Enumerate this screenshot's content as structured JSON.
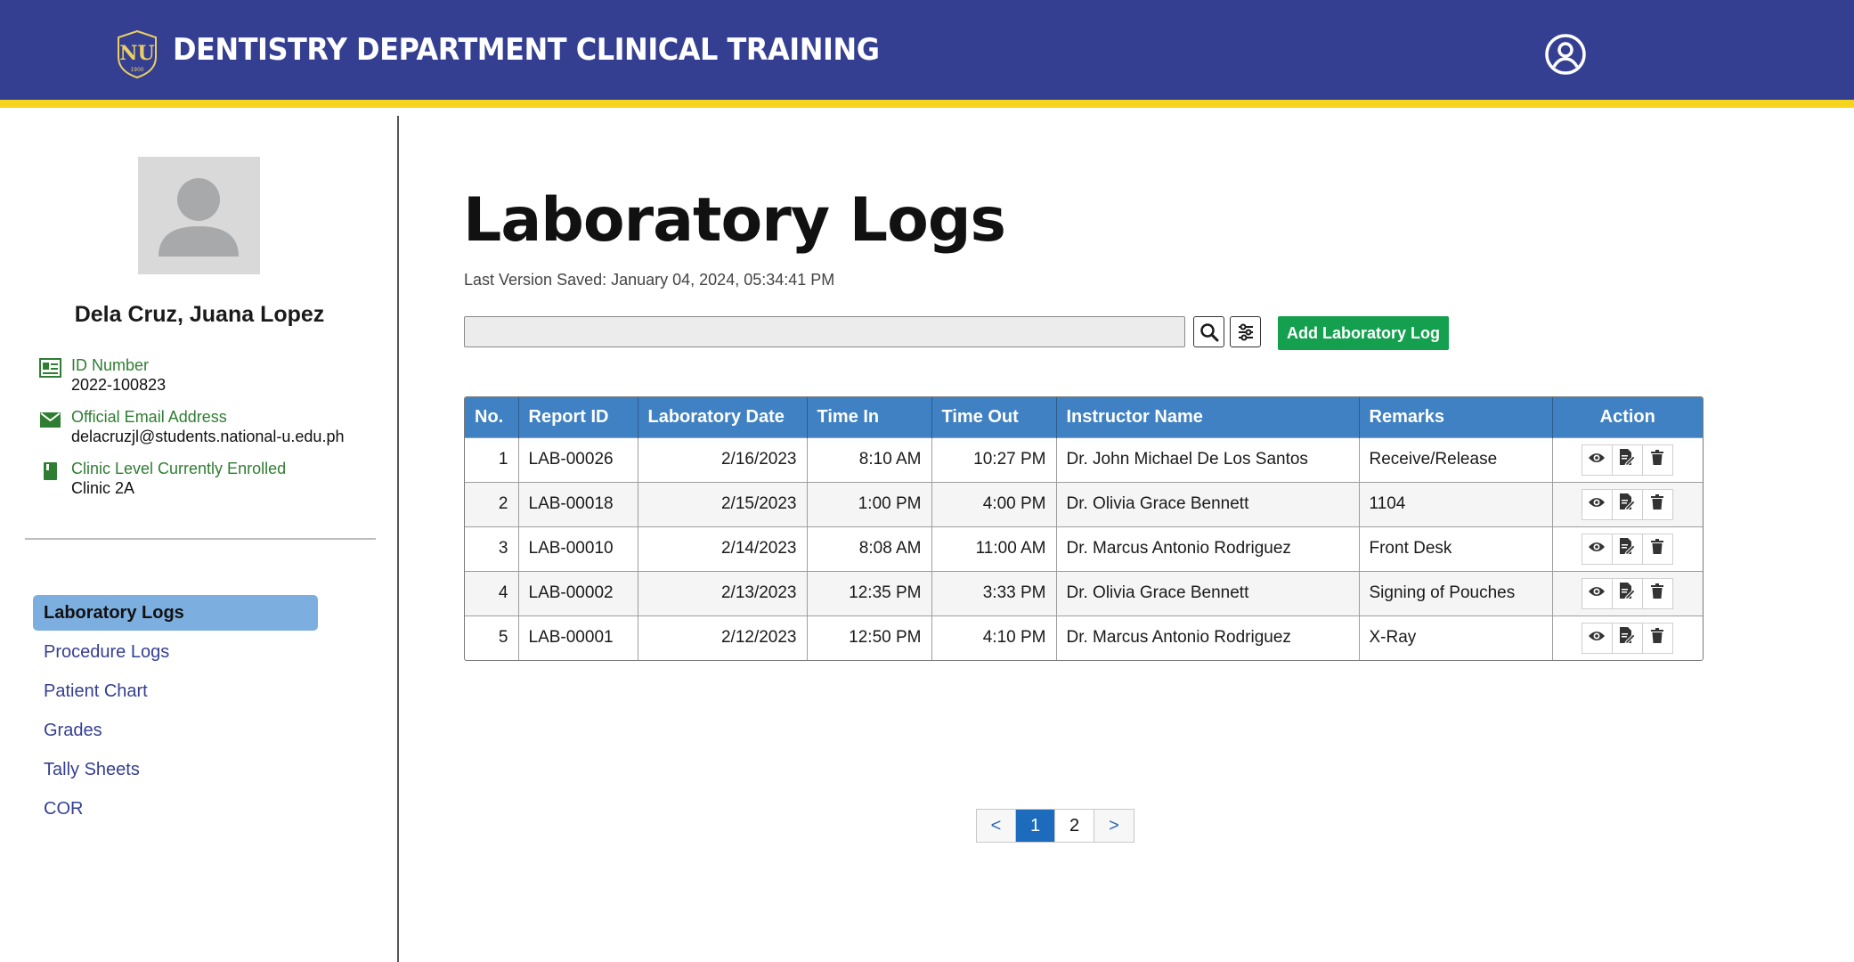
{
  "header": {
    "title": "DENTISTRY DEPARTMENT CLINICAL TRAINING",
    "logo_text": "NU",
    "logo_year": "1900",
    "colors": {
      "bar": "#353f91",
      "accent_stripe": "#f6d31c"
    }
  },
  "profile": {
    "name": "Dela Cruz, Juana Lopez",
    "id_label": "ID Number",
    "id_value": "2022-100823",
    "email_label": "Official Email Address",
    "email_value": "delacruzjl@students.national-u.edu.ph",
    "clinic_label": "Clinic Level Currently Enrolled",
    "clinic_value": "Clinic 2A"
  },
  "nav": {
    "items": [
      {
        "label": "Laboratory Logs",
        "active": true
      },
      {
        "label": "Procedure Logs"
      },
      {
        "label": "Patient Chart"
      },
      {
        "label": "Grades"
      },
      {
        "label": "Tally Sheets"
      },
      {
        "label": "COR"
      }
    ]
  },
  "main": {
    "title": "Laboratory Logs",
    "saved": "Last Version Saved: January 04, 2024, 05:34:41 PM",
    "search_value": "",
    "add_button": "Add Laboratory Log"
  },
  "table": {
    "headers": [
      "No.",
      "Report ID",
      "Laboratory Date",
      "Time In",
      "Time Out",
      "Instructor Name",
      "Remarks",
      "Action"
    ],
    "rows": [
      [
        "1",
        "LAB-00026",
        "2/16/2023",
        "8:10 AM",
        "10:27 PM",
        "Dr. John Michael De Los Santos",
        "Receive/Release"
      ],
      [
        "2",
        "LAB-00018",
        "2/15/2023",
        "1:00 PM",
        "4:00 PM",
        "Dr. Olivia Grace Bennett",
        "1104"
      ],
      [
        "3",
        "LAB-00010",
        "2/14/2023",
        "8:08 AM",
        "11:00 AM",
        "Dr. Marcus Antonio Rodriguez",
        "Front Desk"
      ],
      [
        "4",
        "LAB-00002",
        "2/13/2023",
        "12:35 PM",
        "3:33 PM",
        "Dr. Olivia Grace Bennett",
        "Signing of Pouches"
      ],
      [
        "5",
        "LAB-00001",
        "2/12/2023",
        "12:50 PM",
        "4:10 PM",
        "Dr. Marcus Antonio Rodriguez",
        "X-Ray"
      ]
    ],
    "action_icons": [
      "eye-icon",
      "edit-document-icon",
      "trash-icon"
    ]
  },
  "pagination": {
    "prev": "<",
    "pages": [
      "1",
      "2"
    ],
    "current": "1",
    "next": ">"
  }
}
